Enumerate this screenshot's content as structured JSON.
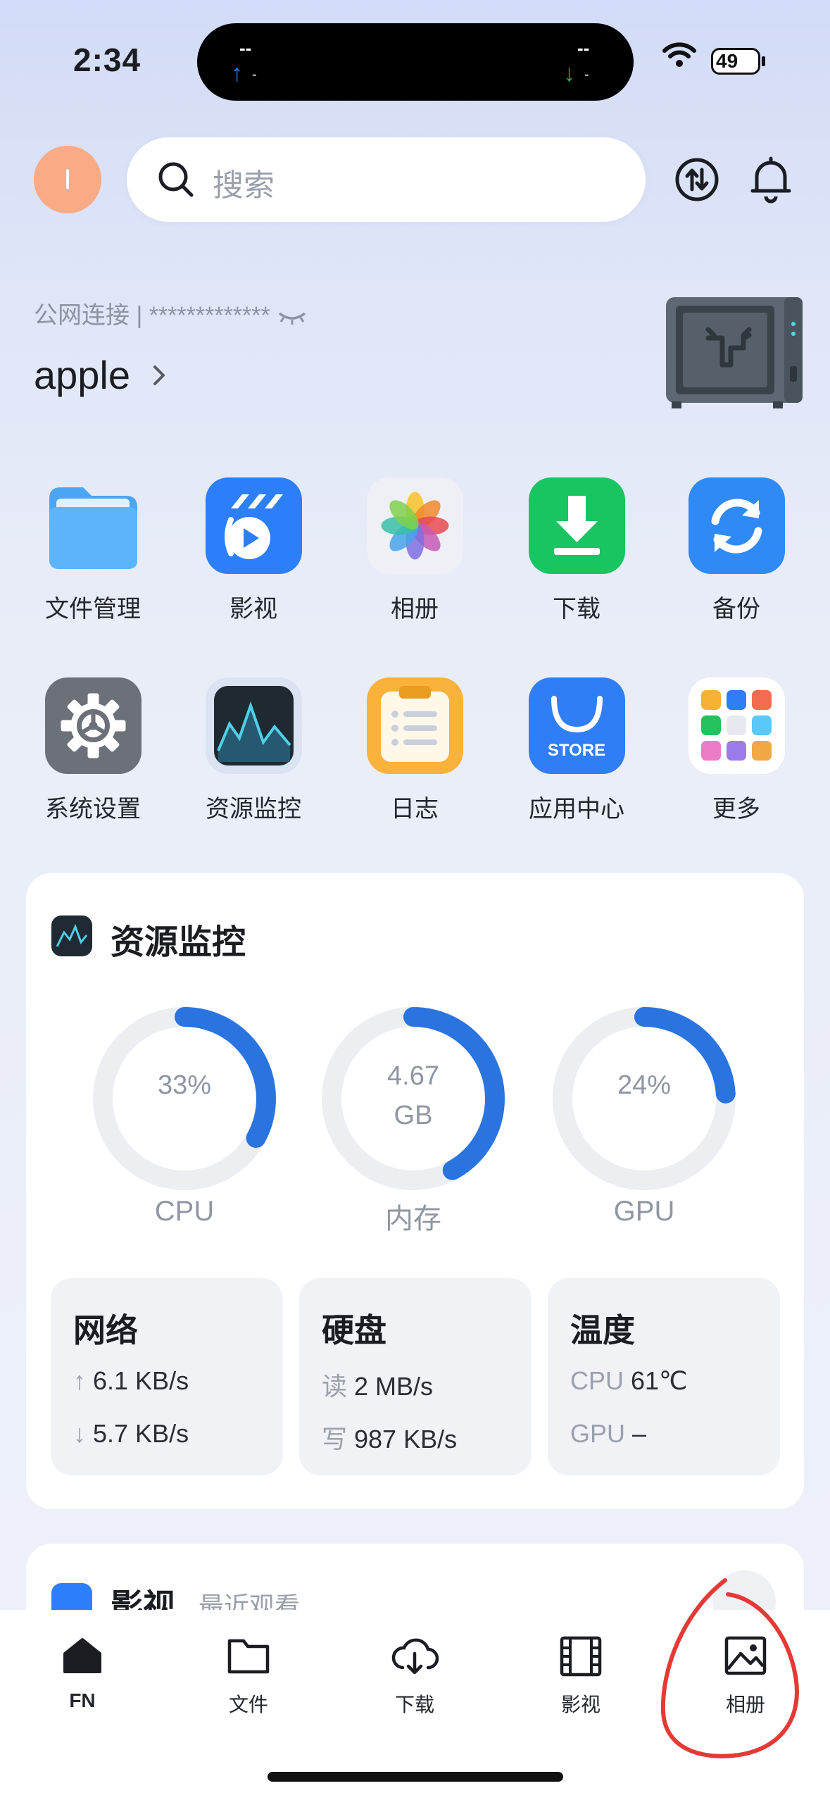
{
  "status": {
    "time": "2:34",
    "island_left_top": "--",
    "island_left_bottom": "-",
    "island_right_top": "--",
    "island_right_bottom": "-",
    "battery": "49"
  },
  "header": {
    "avatar_letter": "I",
    "search_placeholder": "搜索"
  },
  "device": {
    "connection": "公网连接 | ************* ",
    "name": "apple"
  },
  "apps": [
    {
      "label": "文件管理",
      "icon": "folder-icon"
    },
    {
      "label": "影视",
      "icon": "video-icon"
    },
    {
      "label": "相册",
      "icon": "photos-icon"
    },
    {
      "label": "下载",
      "icon": "download-icon"
    },
    {
      "label": "备份",
      "icon": "backup-icon"
    },
    {
      "label": "系统设置",
      "icon": "gear-icon"
    },
    {
      "label": "资源监控",
      "icon": "monitor-icon"
    },
    {
      "label": "日志",
      "icon": "log-icon"
    },
    {
      "label": "应用中心",
      "icon": "store-icon",
      "badge": "STORE"
    },
    {
      "label": "更多",
      "icon": "more-apps-icon"
    }
  ],
  "monitor": {
    "title": "资源监控",
    "gauges": [
      {
        "label": "CPU",
        "value": "33%",
        "fraction": 0.33
      },
      {
        "label": "内存",
        "value": "4.67",
        "unit": "GB",
        "fraction": 0.42
      },
      {
        "label": "GPU",
        "value": "24%",
        "fraction": 0.24
      }
    ],
    "network": {
      "title": "网络",
      "up": "6.1 KB/s",
      "down": "5.7 KB/s"
    },
    "disk": {
      "title": "硬盘",
      "read_label": "读",
      "read": "2 MB/s",
      "write_label": "写",
      "write": "987 KB/s"
    },
    "temp": {
      "title": "温度",
      "cpu_label": "CPU",
      "cpu": "61℃",
      "gpu_label": "GPU",
      "gpu": "–"
    }
  },
  "media_card": {
    "title": "影视",
    "subtitle": "最近观看"
  },
  "tabs": [
    {
      "label": "FN",
      "icon": "home-icon"
    },
    {
      "label": "文件",
      "icon": "folder-icon"
    },
    {
      "label": "下载",
      "icon": "cloud-download-icon"
    },
    {
      "label": "影视",
      "icon": "film-icon"
    },
    {
      "label": "相册",
      "icon": "image-icon"
    }
  ],
  "colors": {
    "accent": "#2a74e0",
    "track": "#eceef2",
    "annotation": "#e53935"
  }
}
